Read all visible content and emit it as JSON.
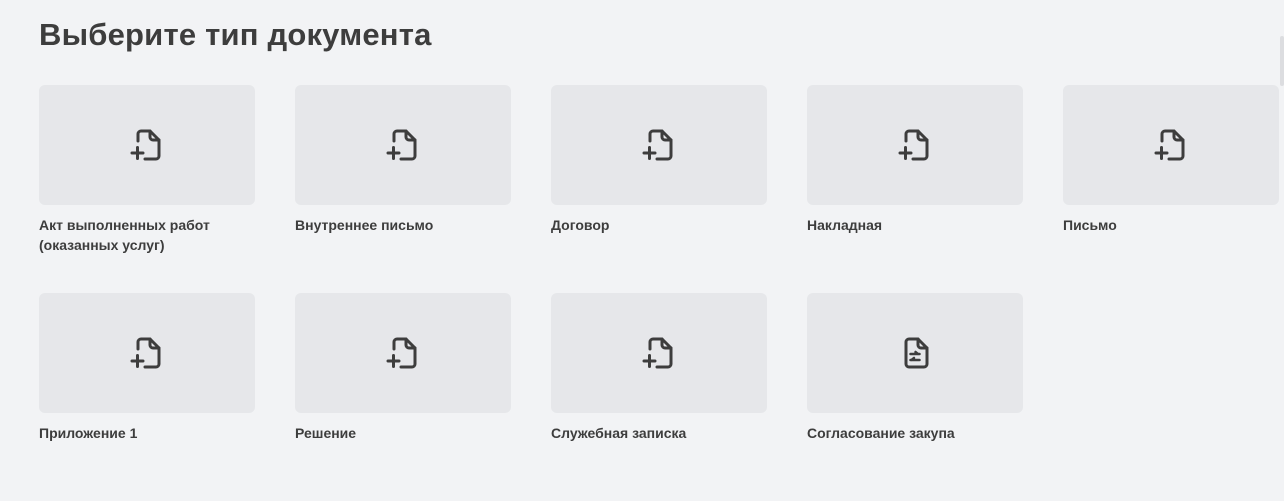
{
  "header": {
    "title": "Выберите тип документа"
  },
  "document_types": [
    {
      "label": "Акт выполненных работ (оказанных услуг)",
      "icon": "file-plus-icon"
    },
    {
      "label": "Внутреннее письмо",
      "icon": "file-plus-icon"
    },
    {
      "label": "Договор",
      "icon": "file-plus-icon"
    },
    {
      "label": "Накладная",
      "icon": "file-plus-icon"
    },
    {
      "label": "Письмо",
      "icon": "file-plus-icon"
    },
    {
      "label": "Приложение 1",
      "icon": "file-plus-icon"
    },
    {
      "label": "Решение",
      "icon": "file-plus-icon"
    },
    {
      "label": "Служебная записка",
      "icon": "file-plus-icon"
    },
    {
      "label": "Согласование закупа",
      "icon": "file-settings-icon"
    }
  ],
  "colors": {
    "background": "#f2f3f5",
    "tile": "#e6e7ea",
    "icon": "#3d3d3d",
    "text": "#3d3d3d"
  }
}
